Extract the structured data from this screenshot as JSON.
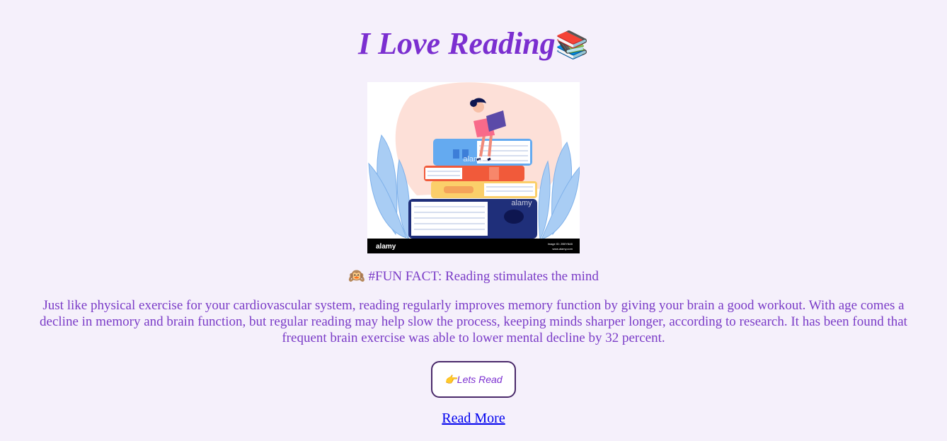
{
  "header": {
    "title": "I Love Reading",
    "title_emoji": "📚"
  },
  "illustration": {
    "watermark": "alamy",
    "footer_brand": "alamy",
    "stock_id_text": "Image ID: 2B0Y8A5",
    "site_text": "www.alamy.com"
  },
  "fact": {
    "emoji": "🙉",
    "text": "#FUN FACT: Reading stimulates the mind"
  },
  "paragraph": "Just like physical exercise for your cardiovascular system, reading regularly improves memory function by giving your brain a good workout. With age comes a decline in memory and brain function, but regular reading may help slow the process, keeping minds sharper longer, according to research. It has been found that frequent brain exercise was able to lower mental decline by 32 percent.",
  "button": {
    "emoji": "👉",
    "label": "Lets Read"
  },
  "link": {
    "label": "Read More"
  },
  "colors": {
    "background": "#f5f0fb",
    "accent": "#7b2fd0",
    "link": "#0000ee"
  }
}
